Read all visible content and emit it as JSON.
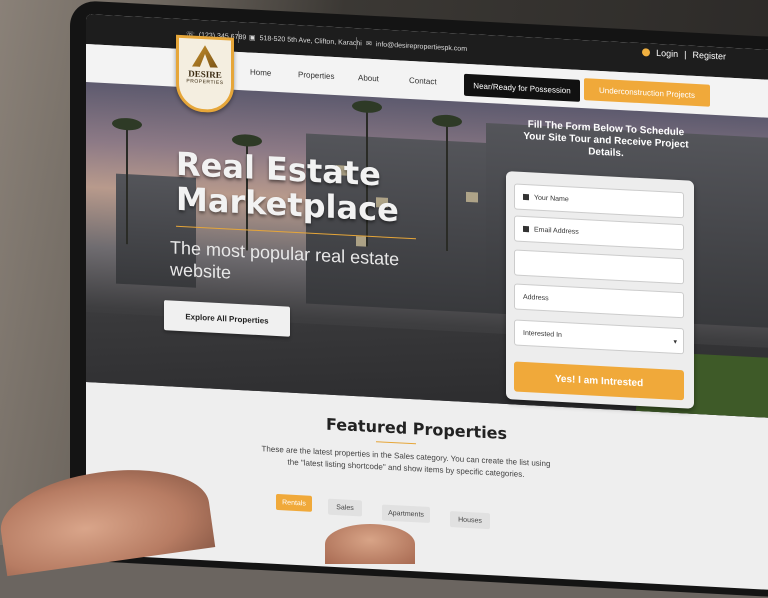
{
  "topbar": {
    "phone": "(123) 345 6789",
    "address": "518-520 5th Ave, Clifton, Karachi",
    "email": "info@desirepropertiespk.com",
    "login_label": "Login",
    "separator": "|",
    "register_label": "Register"
  },
  "logo": {
    "text": "DESIRE",
    "subtext": "PROPERTIES"
  },
  "nav": {
    "links": [
      "Home",
      "Properties",
      "About",
      "Contact"
    ],
    "cta_dark": "Near/Ready for Possession",
    "cta_gold": "Underconstruction Projects"
  },
  "hero": {
    "title": "Real Estate Marketplace",
    "subtitle": "The most popular real estate website",
    "button_label": "Explore All Properties"
  },
  "form": {
    "heading": "Fill The Form Below To Schedule Your Site Tour and Receive Project Details.",
    "name_placeholder": "Your Name",
    "email_placeholder": "Email Address",
    "phone_placeholder": "",
    "address_placeholder": "Address",
    "interest_label": "Interested In",
    "submit_label": "Yes! I am Intrested"
  },
  "featured": {
    "title": "Featured Properties",
    "description": "These are the latest properties in the Sales category. You can create the list using the \"latest listing shortcode\" and show items by specific categories.",
    "tabs": [
      "Rentals",
      "Sales",
      "Apartments",
      "Houses"
    ]
  },
  "colors": {
    "accent": "#f0a93a",
    "dark": "#111111"
  }
}
